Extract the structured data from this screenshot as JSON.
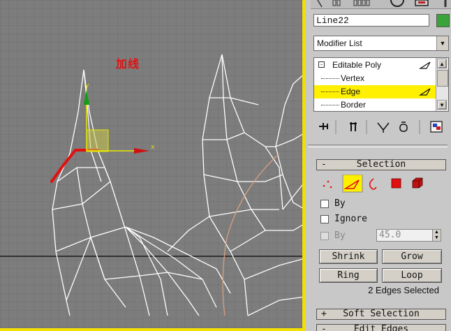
{
  "viewport": {
    "annotation": "加线",
    "gizmo": {
      "y_axis_label": "y",
      "x_axis_label": "x"
    }
  },
  "panel": {
    "top_tab_icons": [
      "create-icon",
      "modify-icon",
      "hierarchy-icon",
      "motion-icon",
      "display-icon",
      "utilities-icon"
    ],
    "object_name": "Line22",
    "object_color": "#3aa43a",
    "modifier_list_label": "Modifier List",
    "stack": {
      "items": [
        {
          "label": "Editable Poly"
        },
        {
          "label": "Vertex"
        },
        {
          "label": "Edge"
        },
        {
          "label": "Border"
        }
      ]
    },
    "tool_icons": [
      "pin-stack-icon",
      "show-end-result-icon",
      "make-unique-icon",
      "remove-modifier-icon",
      "configure-sets-icon"
    ],
    "selection_rollout": {
      "title": "Selection",
      "sign": "-",
      "subobject_icons": [
        "vertex-icon",
        "edge-icon",
        "border-icon",
        "polygon-icon",
        "element-icon"
      ],
      "by_vertex_label": "By",
      "ignore_backfacing_label": "Ignore",
      "by_angle_label": "By",
      "angle_value": "45.0",
      "shrink_label": "Shrink",
      "grow_label": "Grow",
      "ring_label": "Ring",
      "loop_label": "Loop",
      "status": "2 Edges Selected"
    },
    "soft_selection_rollout": {
      "title": "Soft Selection",
      "sign": "+"
    },
    "edit_edges_rollout": {
      "title": "Edit Edges",
      "sign": "-"
    }
  },
  "colors": {
    "highlight": "#ffef00",
    "viewport_border": "#f2e000",
    "viewport_bg": "#7d7d7d",
    "selected_edge": "#e31010"
  }
}
